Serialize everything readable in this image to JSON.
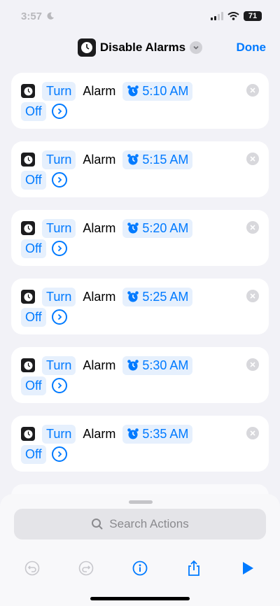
{
  "status_bar": {
    "time": "3:57",
    "battery": "71"
  },
  "nav": {
    "title": "Disable Alarms",
    "done_label": "Done"
  },
  "actions": [
    {
      "verb": "Turn",
      "noun": "Alarm",
      "time": "5:10 AM",
      "state": "Off"
    },
    {
      "verb": "Turn",
      "noun": "Alarm",
      "time": "5:15 AM",
      "state": "Off"
    },
    {
      "verb": "Turn",
      "noun": "Alarm",
      "time": "5:20 AM",
      "state": "Off"
    },
    {
      "verb": "Turn",
      "noun": "Alarm",
      "time": "5:25 AM",
      "state": "Off"
    },
    {
      "verb": "Turn",
      "noun": "Alarm",
      "time": "5:30 AM",
      "state": "Off"
    },
    {
      "verb": "Turn",
      "noun": "Alarm",
      "time": "5:35 AM",
      "state": "Off"
    }
  ],
  "search": {
    "placeholder": "Search Actions"
  },
  "toolbar": {
    "icons": [
      "undo-icon",
      "redo-icon",
      "info-icon",
      "share-icon",
      "play-icon"
    ]
  },
  "colors": {
    "accent": "#007aff",
    "pill_bg": "#e6f0fd",
    "background": "#f2f2f7"
  }
}
